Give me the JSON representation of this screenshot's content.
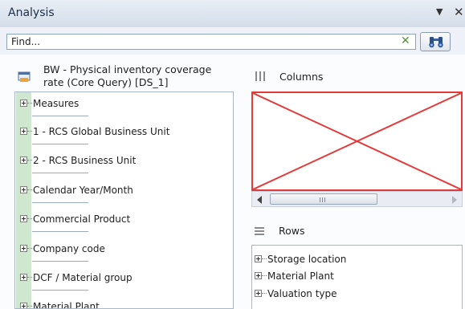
{
  "window": {
    "title": "Analysis"
  },
  "search": {
    "placeholder": "Find...",
    "value": ""
  },
  "data_source": {
    "title_line1": "BW - Physical inventory coverage",
    "title_line2": "rate (Core Query) [DS_1]"
  },
  "tree_items": [
    "Measures",
    "1 - RCS Global Business Unit",
    "2 - RCS Business Unit",
    "Calendar Year/Month",
    "Commercial Product",
    "Company code",
    "DCF / Material group",
    "Material Plant"
  ],
  "columns_panel": {
    "label": "Columns"
  },
  "rows_panel": {
    "label": "Rows",
    "items": [
      "Storage location",
      "Material Plant",
      "Valuation type"
    ]
  },
  "colors": {
    "accent_red": "#e43a3a",
    "green_strip": "#cfe7cf",
    "title_bar": "#d4dde9"
  }
}
